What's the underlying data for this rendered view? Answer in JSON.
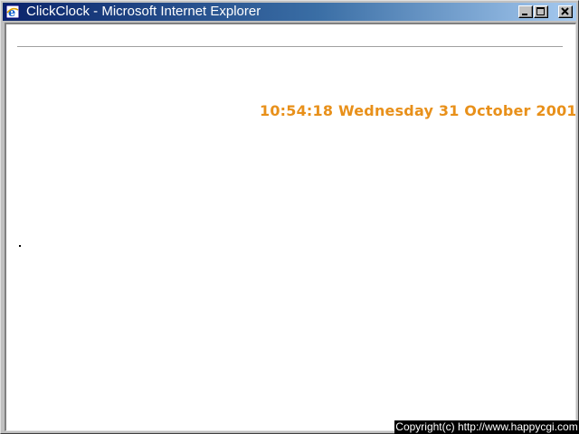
{
  "window": {
    "title": "ClickClock - Microsoft Internet Explorer",
    "icon": "internet-explorer-icon",
    "buttons": {
      "minimize": "minimize-icon",
      "maximize": "maximize-icon",
      "close": "close-icon"
    }
  },
  "page": {
    "clock_text": "10:54:18 Wednesday 31 October 2001",
    "clock_color": "#e8901a"
  },
  "footer": {
    "copyright": "Copyright(c) http://www.happycgi.com"
  }
}
